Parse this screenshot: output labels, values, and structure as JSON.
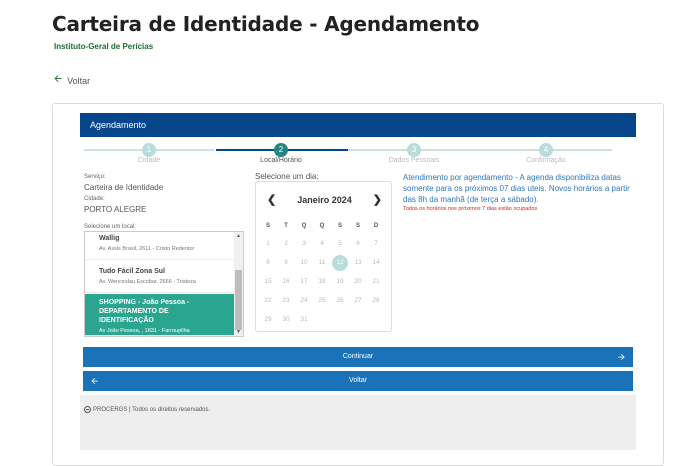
{
  "page": {
    "title": "Carteira de Identidade - Agendamento",
    "subtitle": "Instituto-Geral de Perícias",
    "back_label": "Voltar"
  },
  "panel": {
    "header": "Agendamento"
  },
  "steps": [
    {
      "number": "1",
      "label": "Cidade",
      "active": false
    },
    {
      "number": "2",
      "label": "Local/Horário",
      "active": true
    },
    {
      "number": "3",
      "label": "Dados Pessoais",
      "active": false
    },
    {
      "number": "4",
      "label": "Confirmação",
      "active": false
    }
  ],
  "service": {
    "label": "Serviço:",
    "value": "Carteira de Identidade",
    "city_label": "Cidade:",
    "city_value": "PORTO ALEGRE"
  },
  "locations": {
    "label": "Selecione um local:",
    "items": [
      {
        "name": "Wallig",
        "address": "Av. Assis Brasil, 2611 - Cristo Redentor",
        "selected": false
      },
      {
        "name": "Tudo Fácil Zona Sul",
        "address": "Av. Wenceslau Escobar, 2666 - Tristeza",
        "selected": false
      },
      {
        "name": "SHOPPING - João Pessoa - DEPARTAMENTO DE IDENTIFICAÇÃO",
        "address": "Av João Pessoa, , 1831 - Farroupilha",
        "selected": true
      }
    ]
  },
  "calendar": {
    "label": "Selecione um dia:",
    "month_title": "Janeiro 2024",
    "weekdays": [
      "S",
      "T",
      "Q",
      "Q",
      "S",
      "S",
      "D"
    ],
    "weeks": [
      [
        "1",
        "2",
        "3",
        "4",
        "5",
        "6",
        "7"
      ],
      [
        "8",
        "9",
        "10",
        "11",
        "12",
        "13",
        "14"
      ],
      [
        "15",
        "16",
        "17",
        "18",
        "19",
        "20",
        "21"
      ],
      [
        "22",
        "23",
        "24",
        "25",
        "26",
        "27",
        "28"
      ],
      [
        "29",
        "30",
        "31",
        "",
        "",
        "",
        ""
      ]
    ],
    "highlighted_day": "12",
    "prev_icon": "chevron-left-icon",
    "next_icon": "chevron-right-icon"
  },
  "notice": {
    "text": "Atendimento por agendamento - A agenda disponibiliza datas somente para os próximos 07 dias uteis. Novos horários a partir das 8h da manhã (de terça a sábado).",
    "warning": "Todos os horários nos próximos 7 dias estão ocupados"
  },
  "buttons": {
    "continue": "Continuar",
    "back": "Voltar"
  },
  "footer": {
    "text": "PROCERGS | Todos os direitos reservados."
  },
  "colors": {
    "header_blue": "#07468a",
    "button_blue": "#1a72b8",
    "selected_teal": "#2aa58f",
    "step_active": "#24877d",
    "subtitle_green": "#1d6e2f"
  }
}
